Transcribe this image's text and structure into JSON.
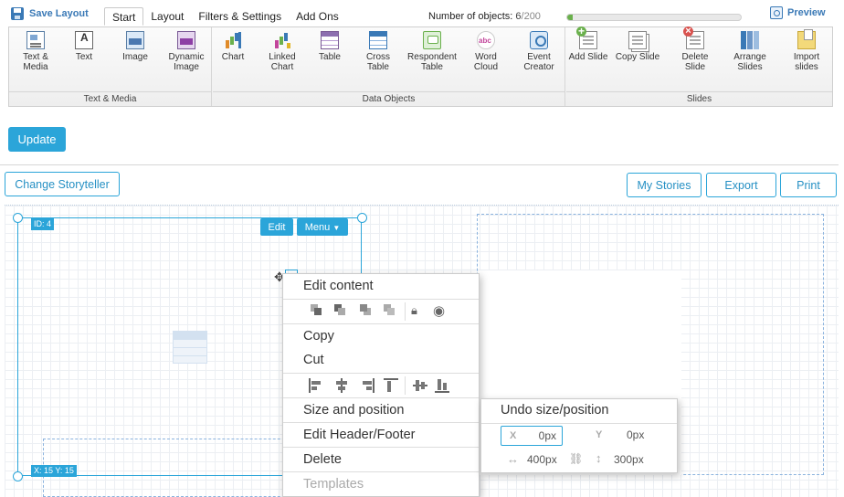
{
  "toolbar": {
    "save_layout": "Save Layout",
    "tabs": [
      {
        "label": "Start",
        "active": true
      },
      {
        "label": "Layout",
        "active": false
      },
      {
        "label": "Filters & Settings",
        "active": false
      },
      {
        "label": "Add Ons",
        "active": false
      }
    ],
    "object_count_label": "Number of objects:",
    "object_count_current": "6",
    "object_count_max": "/200",
    "object_progress_fraction": 0.03,
    "preview": "Preview"
  },
  "ribbon": {
    "groups": [
      {
        "label": "Text & Media",
        "buttons": [
          {
            "line1": "Text &",
            "line2": "Media",
            "icon": "text-media-icon"
          },
          {
            "line1": "Text",
            "line2": "",
            "icon": "text-icon"
          },
          {
            "line1": "Image",
            "line2": "",
            "icon": "image-icon"
          },
          {
            "line1": "Dynamic",
            "line2": "Image",
            "icon": "dynamic-image-icon"
          }
        ]
      },
      {
        "label": "Data Objects",
        "buttons": [
          {
            "line1": "Chart",
            "line2": "",
            "icon": "chart-icon"
          },
          {
            "line1": "Linked",
            "line2": "Chart",
            "icon": "linked-chart-icon"
          },
          {
            "line1": "Table",
            "line2": "",
            "icon": "table-icon"
          },
          {
            "line1": "Cross",
            "line2": "Table",
            "icon": "cross-table-icon"
          },
          {
            "line1": "Respondent",
            "line2": "Table",
            "icon": "respondent-table-icon"
          },
          {
            "line1": "Word",
            "line2": "Cloud",
            "icon": "word-cloud-icon"
          },
          {
            "line1": "Event",
            "line2": "Creator",
            "icon": "event-creator-icon"
          }
        ]
      },
      {
        "label": "Slides",
        "buttons": [
          {
            "line1": "Add Slide",
            "line2": "",
            "icon": "add-slide-icon"
          },
          {
            "line1": "Copy Slide",
            "line2": "",
            "icon": "copy-slide-icon"
          },
          {
            "line1": "Delete",
            "line2": "Slide",
            "icon": "delete-slide-icon"
          },
          {
            "line1": "Arrange",
            "line2": "Slides",
            "icon": "arrange-slides-icon"
          },
          {
            "line1": "Import",
            "line2": "slides",
            "icon": "import-slides-icon"
          }
        ]
      }
    ]
  },
  "actions": {
    "update": "Update",
    "change_storyteller": "Change Storyteller",
    "my_stories": "My Stories",
    "export": "Export",
    "print": "Print"
  },
  "canvas": {
    "selected_id": "ID: 4",
    "selected_xy": "X: 15 Y: 15",
    "edit": "Edit",
    "menu": "Menu"
  },
  "context_menu": {
    "edit_content": "Edit content",
    "copy": "Copy",
    "cut": "Cut",
    "size_and_position": "Size and position",
    "edit_header_footer": "Edit Header/Footer",
    "delete": "Delete",
    "templates": "Templates"
  },
  "size_panel": {
    "undo": "Undo size/position",
    "x_label": "X",
    "x_value": "0px",
    "y_label": "Y",
    "y_value": "0px",
    "width_value": "400px",
    "height_value": "300px"
  },
  "colors": {
    "accent": "#2ba5d9",
    "link": "#3a79b6",
    "progress": "#6ab04c"
  }
}
